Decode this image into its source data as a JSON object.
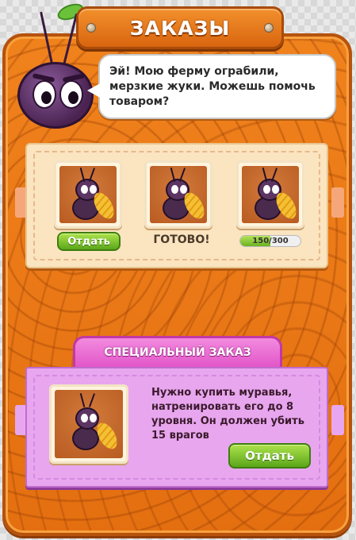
{
  "header": {
    "title": "ЗАКАЗЫ"
  },
  "dialog": {
    "text": "Эй! Мою ферму ограбили, мерзкие жуки. Можешь помочь товаром?"
  },
  "orders": [
    {
      "status": "button",
      "label": "Отдать"
    },
    {
      "status": "ready",
      "label": "ГОТОВО!"
    },
    {
      "status": "progress",
      "progress_text": "150/300",
      "progress_fraction": 0.5
    }
  ],
  "special": {
    "title": "СПЕЦИАЛЬНЫЙ ЗАКАЗ",
    "text": "Нужно купить муравья, натренировать его до 8 уровня. Он должен убить 15 врагов",
    "button_label": "Отдать"
  },
  "colors": {
    "board": "#e46f10",
    "orders_panel": "#fbe4c0",
    "special_panel": "#e8a6ee",
    "button_green": "#6ab31f"
  }
}
